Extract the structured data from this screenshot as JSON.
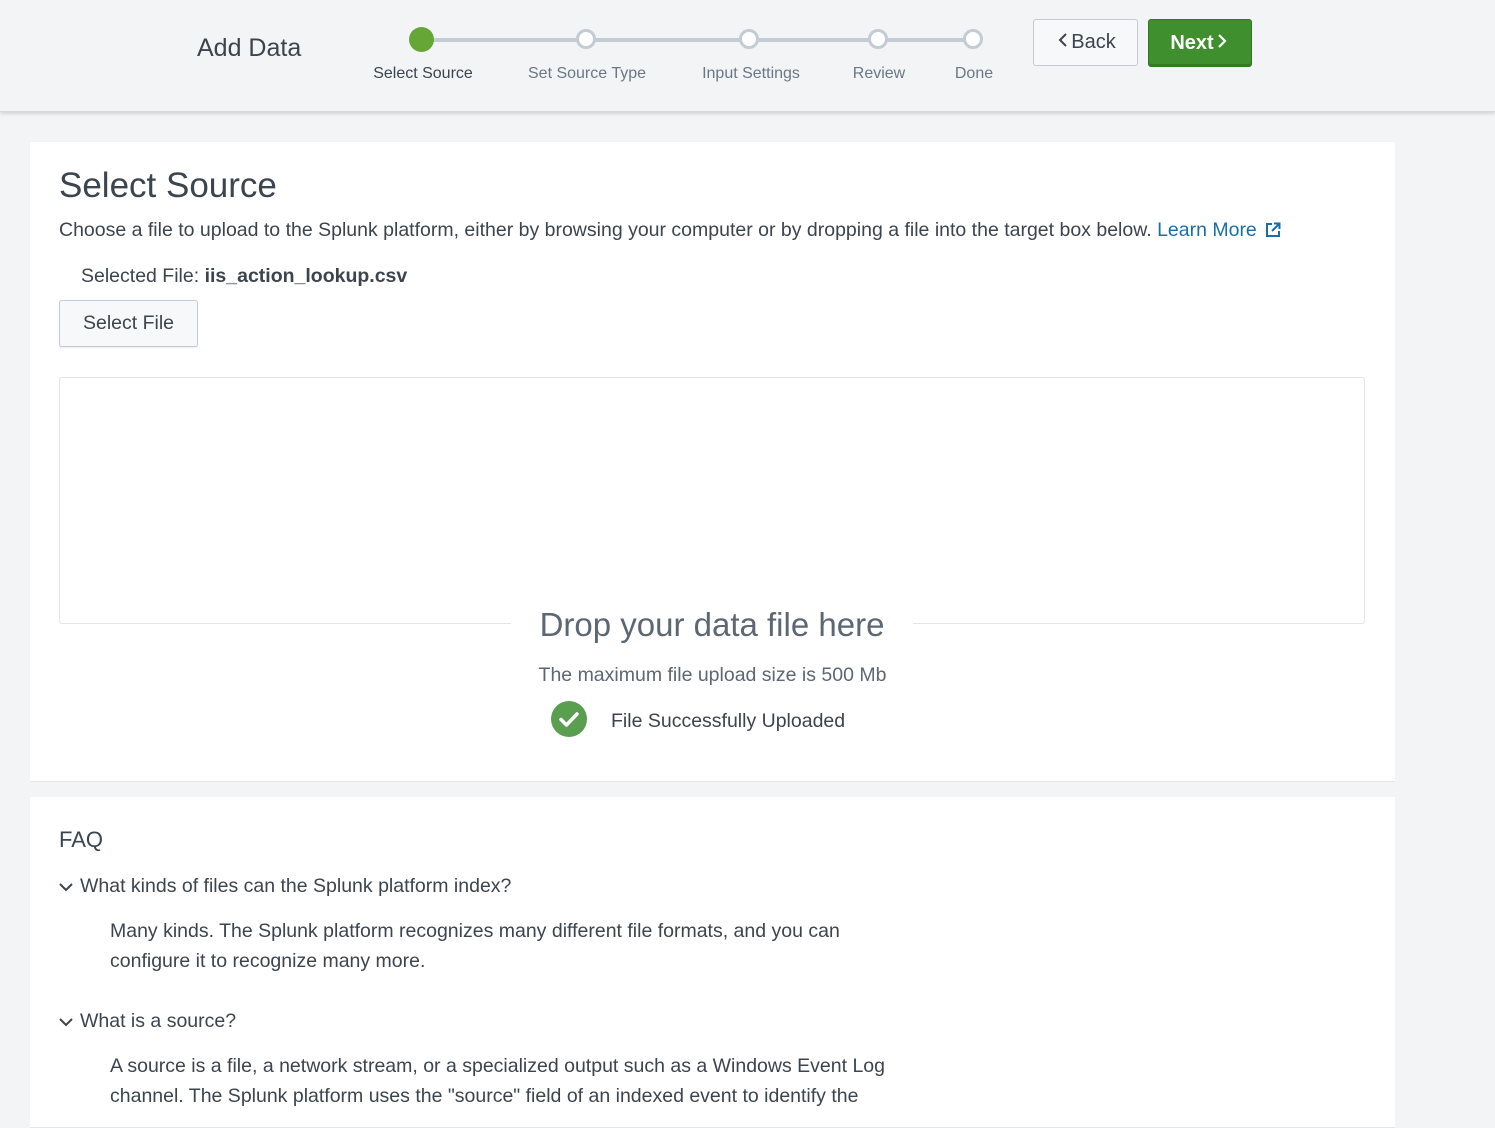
{
  "header": {
    "title": "Add Data",
    "steps": [
      {
        "label": "Select Source"
      },
      {
        "label": "Set Source Type"
      },
      {
        "label": "Input Settings"
      },
      {
        "label": "Review"
      },
      {
        "label": "Done"
      }
    ],
    "back_label": "Back",
    "next_label": "Next",
    "colors": {
      "active_step": "#65a637",
      "next_button": "#3f8f2e"
    }
  },
  "main": {
    "title": "Select Source",
    "description": "Choose a file to upload to the Splunk platform, either by browsing your computer or by dropping a file into the target box below.",
    "learn_more": "Learn More",
    "selected_file_label": "Selected File:",
    "selected_file_name": "iis_action_lookup.csv",
    "select_file_button": "Select File",
    "drop_text": "Drop your data file here",
    "max_size_text": "The maximum file upload size is 500 Mb",
    "status_text": "File Successfully Uploaded"
  },
  "faq": {
    "title": "FAQ",
    "items": [
      {
        "question": "What kinds of files can the Splunk platform index?",
        "answer_line1": "Many kinds. The Splunk platform recognizes many different file formats, and you can",
        "answer_line2": "configure it to recognize many more."
      },
      {
        "question": "What is a source?",
        "answer_line1": "A source is a file, a network stream, or a specialized output such as a Windows Event Log",
        "answer_line2": "channel. The Splunk platform uses the \"source\" field of an indexed event to identify the"
      }
    ]
  }
}
